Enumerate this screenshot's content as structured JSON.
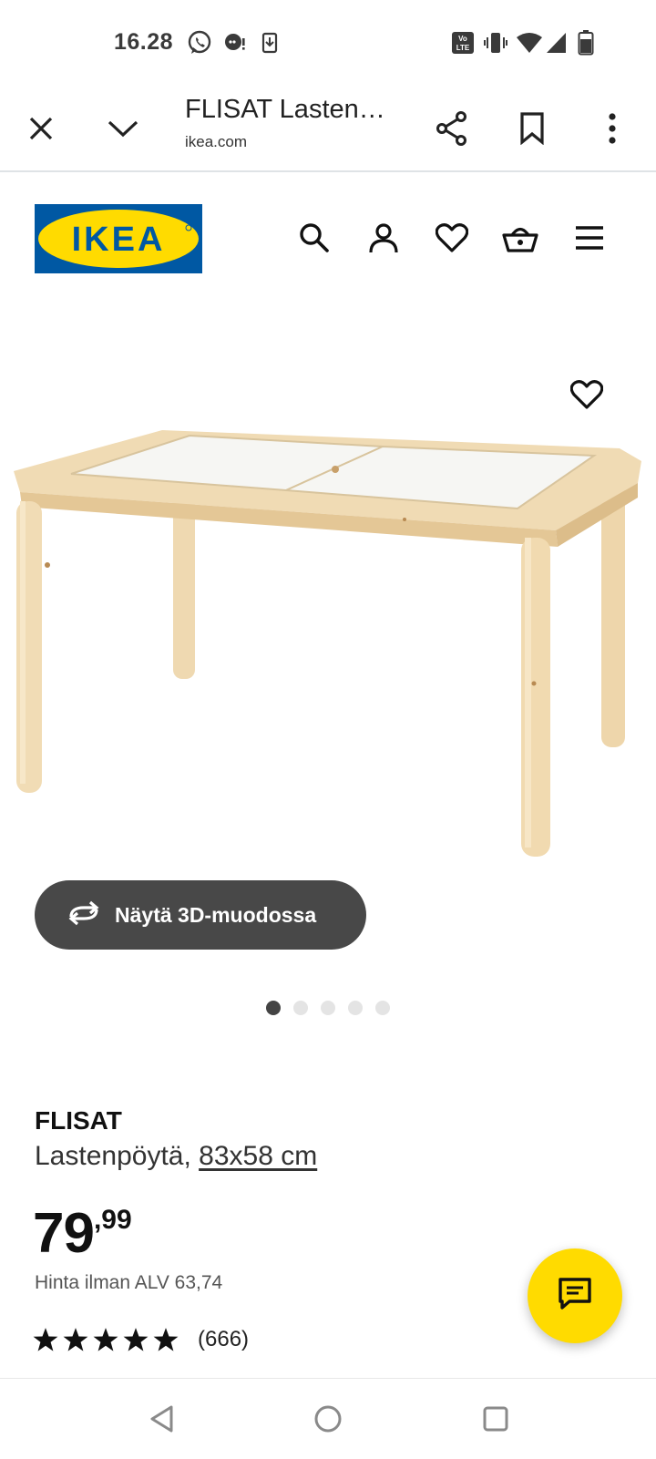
{
  "status_bar": {
    "time": "16.28",
    "volte_label": "Vo LTE",
    "icons": [
      "whatsapp-icon",
      "chat-bubble-icon",
      "download-icon",
      "volte-icon",
      "vibrate-icon",
      "wifi-icon",
      "signal-icon",
      "battery-icon"
    ]
  },
  "browser": {
    "tab_title": "FLISAT Lasten…",
    "url": "ikea.com",
    "icons": [
      "close-icon",
      "chevron-down-icon",
      "share-icon",
      "bookmark-icon",
      "more-vert-icon"
    ]
  },
  "header": {
    "logo_text": "IKEA",
    "icons": [
      "search-icon",
      "profile-icon",
      "heart-icon",
      "basket-icon",
      "menu-icon"
    ],
    "brand_colors": {
      "blue": "#0058A3",
      "yellow": "#FFDB00"
    }
  },
  "gallery": {
    "view_3d_label": "Näytä 3D-muodossa",
    "image_count": 5,
    "active_index": 1,
    "icons": [
      "heart-icon",
      "rotate-3d-icon"
    ]
  },
  "product": {
    "name": "FLISAT",
    "description": "Lastenpöytä, ",
    "size": "83x58 cm",
    "price_integer": "79",
    "price_decimal": ",99",
    "price_without_vat": "Hinta ilman ALV 63,74",
    "rating_stars": 5,
    "rating_max": 5,
    "review_count": "(666)"
  },
  "chat": {
    "icon": "chat-icon",
    "color": "#FFDB00"
  },
  "nav": {
    "icons": [
      "back-icon",
      "home-icon",
      "recents-icon"
    ]
  }
}
